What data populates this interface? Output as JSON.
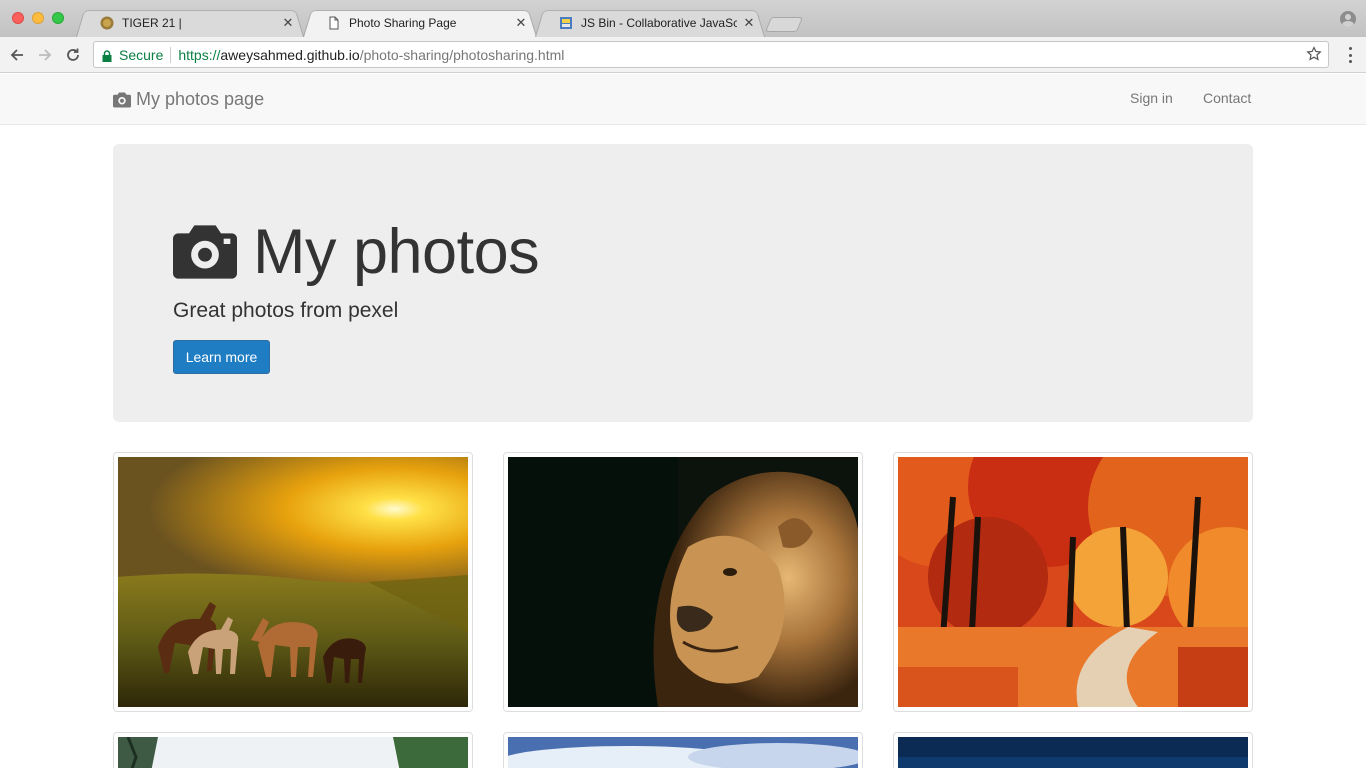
{
  "browser": {
    "tabs": [
      {
        "title": "TIGER 21 |",
        "active": false,
        "favicon": "tiger21-favicon"
      },
      {
        "title": "Photo Sharing Page",
        "active": true,
        "favicon": "document-icon"
      },
      {
        "title": "JS Bin - Collaborative JavaScri",
        "active": false,
        "favicon": "jsbin-favicon"
      }
    ],
    "address": {
      "security_label": "Secure",
      "url_scheme": "https://",
      "url_host": "aweysahmed.github.io",
      "url_path": "/photo-sharing/photosharing.html"
    },
    "colors": {
      "secure_green": "#0b8043"
    }
  },
  "navbar": {
    "brand": "My photos page",
    "brand_icon": "camera-icon",
    "links": [
      "Sign in",
      "Contact"
    ]
  },
  "jumbotron": {
    "title": "My photos",
    "title_icon": "camera-icon",
    "subtitle": "Great photos from pexel",
    "button_label": "Learn more",
    "button_color": "#1f7dc4"
  },
  "gallery": {
    "photos": [
      {
        "subject": "horses-at-sunset"
      },
      {
        "subject": "lion-portrait"
      },
      {
        "subject": "autumn-forest-path"
      },
      {
        "subject": "forest-trees"
      },
      {
        "subject": "mountain-sky"
      },
      {
        "subject": "night-sky"
      }
    ]
  }
}
